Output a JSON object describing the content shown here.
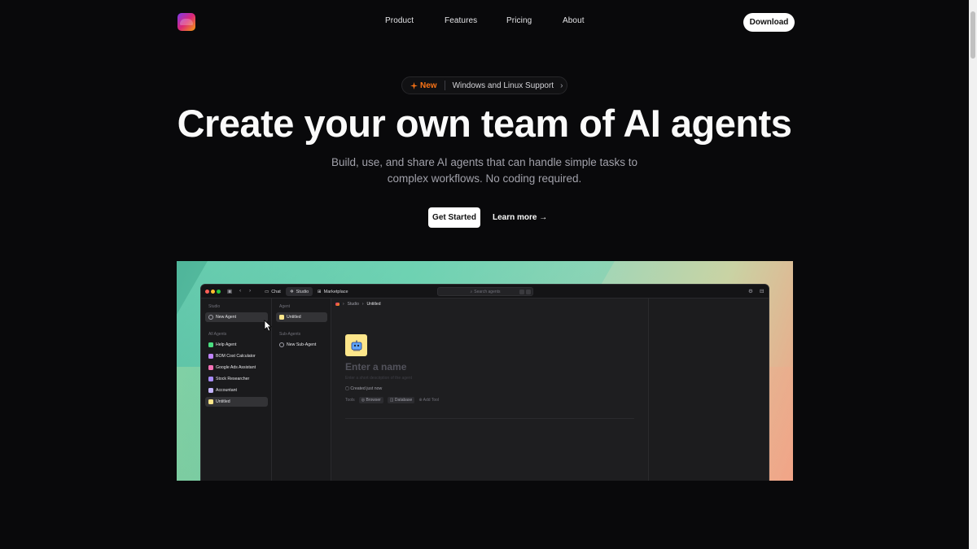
{
  "nav": {
    "links": [
      "Product",
      "Features",
      "Pricing",
      "About"
    ],
    "download": "Download"
  },
  "badge": {
    "tag": "New",
    "text": "Windows and Linux Support"
  },
  "hero": {
    "headline": "Create your own team of AI agents",
    "subtitle": "Build, use, and share AI agents that can handle simple tasks to complex workflows. No coding required.",
    "cta": "Get Started",
    "learn_more": "Learn more →"
  },
  "app": {
    "tabs": [
      "Chat",
      "Studio",
      "Marketplace"
    ],
    "search_placeholder": "Search agents",
    "studio_section": "Studio",
    "new_agent": "New Agent",
    "all_agents_section": "All Agents",
    "agents": [
      {
        "label": "Help Agent",
        "color": "#4ade80"
      },
      {
        "label": "BOM Cost Calculator",
        "color": "#c084fc"
      },
      {
        "label": "Google Ads Assistant",
        "color": "#f472b6"
      },
      {
        "label": "Stock Researcher",
        "color": "#a78bfa"
      },
      {
        "label": "Accountant",
        "color": "#c4b5fd"
      },
      {
        "label": "Untitled",
        "color": "#fde68a"
      }
    ],
    "agent_section": "Agent",
    "agent_item": "Untitled",
    "sub_agents_section": "Sub-Agents",
    "new_sub_agent": "New Sub-Agent",
    "breadcrumb": [
      "Studio",
      "Untitled"
    ],
    "name_placeholder": "Enter a name",
    "desc_placeholder": "Enter a short description of the agent",
    "created": "Created just now",
    "tools_label": "Tools",
    "tools": [
      "Browser",
      "Database"
    ],
    "add_tool": "Add Tool"
  },
  "colors": {
    "background": "#09090b",
    "accent_new": "#f97316"
  }
}
